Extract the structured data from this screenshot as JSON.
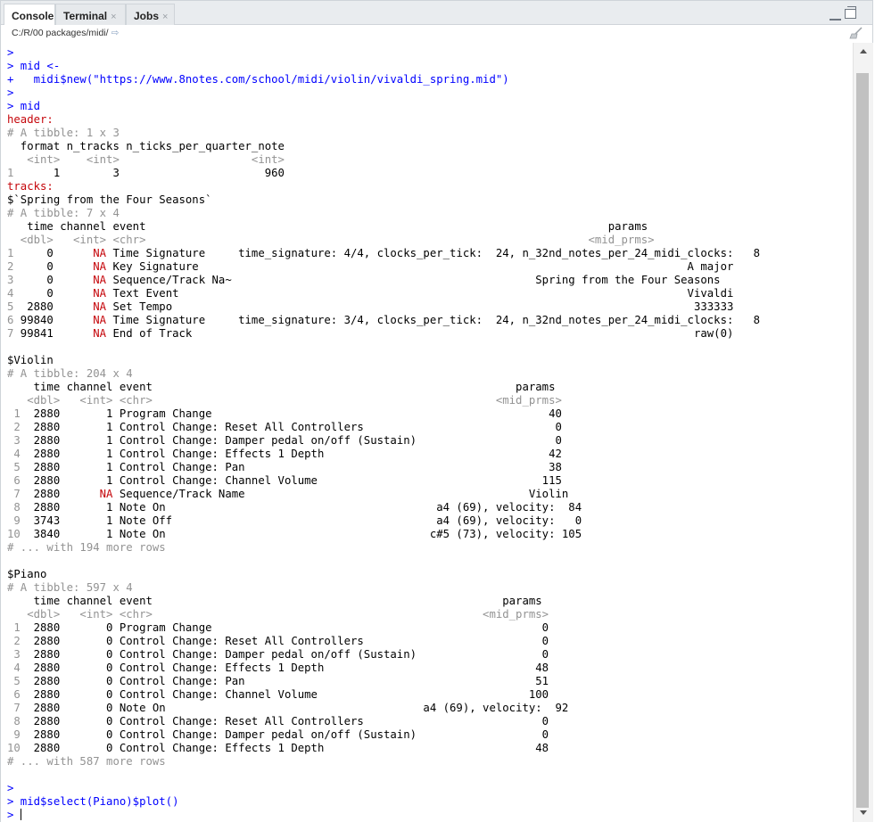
{
  "tabs": [
    {
      "label": "Console",
      "active": true
    },
    {
      "label": "Terminal",
      "close": "×"
    },
    {
      "label": "Jobs",
      "close": "×"
    }
  ],
  "path": "C:/R/00 packages/midi/",
  "console_lines": [
    {
      "segs": [
        {
          "t": ">",
          "c": "prompt"
        }
      ]
    },
    {
      "segs": [
        {
          "t": "> mid <-",
          "c": "prompt"
        }
      ]
    },
    {
      "segs": [
        {
          "t": "+   midi$new(\"https://www.8notes.com/school/midi/violin/vivaldi_spring.mid\")",
          "c": "prompt"
        }
      ]
    },
    {
      "segs": [
        {
          "t": ">",
          "c": "prompt"
        }
      ]
    },
    {
      "segs": [
        {
          "t": "> mid",
          "c": "prompt"
        }
      ]
    },
    {
      "segs": [
        {
          "t": "header:",
          "c": "red"
        }
      ]
    },
    {
      "segs": [
        {
          "t": "# A tibble: 1 x 3",
          "c": "gray"
        }
      ]
    },
    {
      "segs": [
        {
          "t": "  format n_tracks n_ticks_per_quarter_note"
        }
      ]
    },
    {
      "segs": [
        {
          "t": "   <int>    <int>                    <int>",
          "c": "gray"
        }
      ]
    },
    {
      "segs": [
        {
          "t": "1",
          "c": "gray"
        },
        {
          "t": "      1        3                      960"
        }
      ]
    },
    {
      "segs": [
        {
          "t": "tracks:",
          "c": "red"
        }
      ]
    },
    {
      "segs": [
        {
          "t": "$`Spring from the Four Seasons`"
        }
      ]
    },
    {
      "segs": [
        {
          "t": "# A tibble: 7 x 4",
          "c": "gray"
        }
      ]
    },
    {
      "segs": [
        {
          "t": "   time channel event                                                                      params"
        }
      ]
    },
    {
      "segs": [
        {
          "t": "  <dbl>   <int> <chr>                                                                   <mid_prms>",
          "c": "gray"
        }
      ]
    },
    {
      "segs": [
        {
          "t": "1",
          "c": "gray"
        },
        {
          "t": "     0      "
        },
        {
          "t": "NA",
          "c": "na"
        },
        {
          "t": " Time Signature     time_signature: 4/4, clocks_per_tick:  24, n_32nd_notes_per_24_midi_clocks:   8"
        }
      ]
    },
    {
      "segs": [
        {
          "t": "2",
          "c": "gray"
        },
        {
          "t": "     0      "
        },
        {
          "t": "NA",
          "c": "na"
        },
        {
          "t": " Key Signature                                                                          A major"
        }
      ]
    },
    {
      "segs": [
        {
          "t": "3",
          "c": "gray"
        },
        {
          "t": "     0      "
        },
        {
          "t": "NA",
          "c": "na"
        },
        {
          "t": " Sequence/Track Na~                                              Spring from the Four Seasons"
        }
      ]
    },
    {
      "segs": [
        {
          "t": "4",
          "c": "gray"
        },
        {
          "t": "     0      "
        },
        {
          "t": "NA",
          "c": "na"
        },
        {
          "t": " Text Event                                                                             Vivaldi"
        }
      ]
    },
    {
      "segs": [
        {
          "t": "5",
          "c": "gray"
        },
        {
          "t": "  2880      "
        },
        {
          "t": "NA",
          "c": "na"
        },
        {
          "t": " Set Tempo                                                                               333333"
        }
      ]
    },
    {
      "segs": [
        {
          "t": "6",
          "c": "gray"
        },
        {
          "t": " 99840      "
        },
        {
          "t": "NA",
          "c": "na"
        },
        {
          "t": " Time Signature     time_signature: 3/4, clocks_per_tick:  24, n_32nd_notes_per_24_midi_clocks:   8"
        }
      ]
    },
    {
      "segs": [
        {
          "t": "7",
          "c": "gray"
        },
        {
          "t": " 99841      "
        },
        {
          "t": "NA",
          "c": "na"
        },
        {
          "t": " End of Track                                                                            raw(0)"
        }
      ]
    },
    {
      "segs": [
        {
          "t": " "
        }
      ]
    },
    {
      "segs": [
        {
          "t": "$Violin"
        }
      ]
    },
    {
      "segs": [
        {
          "t": "# A tibble: 204 x 4",
          "c": "gray"
        }
      ]
    },
    {
      "segs": [
        {
          "t": "    time channel event                                                       params"
        }
      ]
    },
    {
      "segs": [
        {
          "t": "   <dbl>   <int> <chr>                                                    <mid_prms>",
          "c": "gray"
        }
      ]
    },
    {
      "segs": [
        {
          "t": " 1",
          "c": "gray"
        },
        {
          "t": "  2880       1 Program Change                                                   40"
        }
      ]
    },
    {
      "segs": [
        {
          "t": " 2",
          "c": "gray"
        },
        {
          "t": "  2880       1 Control Change: Reset All Controllers                             0"
        }
      ]
    },
    {
      "segs": [
        {
          "t": " 3",
          "c": "gray"
        },
        {
          "t": "  2880       1 Control Change: Damper pedal on/off (Sustain)                     0"
        }
      ]
    },
    {
      "segs": [
        {
          "t": " 4",
          "c": "gray"
        },
        {
          "t": "  2880       1 Control Change: Effects 1 Depth                                  42"
        }
      ]
    },
    {
      "segs": [
        {
          "t": " 5",
          "c": "gray"
        },
        {
          "t": "  2880       1 Control Change: Pan                                              38"
        }
      ]
    },
    {
      "segs": [
        {
          "t": " 6",
          "c": "gray"
        },
        {
          "t": "  2880       1 Control Change: Channel Volume                                  115"
        }
      ]
    },
    {
      "segs": [
        {
          "t": " 7",
          "c": "gray"
        },
        {
          "t": "  2880      "
        },
        {
          "t": "NA",
          "c": "na"
        },
        {
          "t": " Sequence/Track Name                                           Violin"
        }
      ]
    },
    {
      "segs": [
        {
          "t": " 8",
          "c": "gray"
        },
        {
          "t": "  2880       1 Note On                                         a4 (69), velocity:  84"
        }
      ]
    },
    {
      "segs": [
        {
          "t": " 9",
          "c": "gray"
        },
        {
          "t": "  3743       1 Note Off                                        a4 (69), velocity:   0"
        }
      ]
    },
    {
      "segs": [
        {
          "t": "10",
          "c": "gray"
        },
        {
          "t": "  3840       1 Note On                                        c#5 (73), velocity: 105"
        }
      ]
    },
    {
      "segs": [
        {
          "t": "# ... with 194 more rows",
          "c": "gray"
        }
      ]
    },
    {
      "segs": [
        {
          "t": " "
        }
      ]
    },
    {
      "segs": [
        {
          "t": "$Piano"
        }
      ]
    },
    {
      "segs": [
        {
          "t": "# A tibble: 597 x 4",
          "c": "gray"
        }
      ]
    },
    {
      "segs": [
        {
          "t": "    time channel event                                                     params"
        }
      ]
    },
    {
      "segs": [
        {
          "t": "   <dbl>   <int> <chr>                                                  <mid_prms>",
          "c": "gray"
        }
      ]
    },
    {
      "segs": [
        {
          "t": " 1",
          "c": "gray"
        },
        {
          "t": "  2880       0 Program Change                                                  0"
        }
      ]
    },
    {
      "segs": [
        {
          "t": " 2",
          "c": "gray"
        },
        {
          "t": "  2880       0 Control Change: Reset All Controllers                           0"
        }
      ]
    },
    {
      "segs": [
        {
          "t": " 3",
          "c": "gray"
        },
        {
          "t": "  2880       0 Control Change: Damper pedal on/off (Sustain)                   0"
        }
      ]
    },
    {
      "segs": [
        {
          "t": " 4",
          "c": "gray"
        },
        {
          "t": "  2880       0 Control Change: Effects 1 Depth                                48"
        }
      ]
    },
    {
      "segs": [
        {
          "t": " 5",
          "c": "gray"
        },
        {
          "t": "  2880       0 Control Change: Pan                                            51"
        }
      ]
    },
    {
      "segs": [
        {
          "t": " 6",
          "c": "gray"
        },
        {
          "t": "  2880       0 Control Change: Channel Volume                                100"
        }
      ]
    },
    {
      "segs": [
        {
          "t": " 7",
          "c": "gray"
        },
        {
          "t": "  2880       0 Note On                                       a4 (69), velocity:  92"
        }
      ]
    },
    {
      "segs": [
        {
          "t": " 8",
          "c": "gray"
        },
        {
          "t": "  2880       0 Control Change: Reset All Controllers                           0"
        }
      ]
    },
    {
      "segs": [
        {
          "t": " 9",
          "c": "gray"
        },
        {
          "t": "  2880       0 Control Change: Damper pedal on/off (Sustain)                   0"
        }
      ]
    },
    {
      "segs": [
        {
          "t": "10",
          "c": "gray"
        },
        {
          "t": "  2880       0 Control Change: Effects 1 Depth                                48"
        }
      ]
    },
    {
      "segs": [
        {
          "t": "# ... with 587 more rows",
          "c": "gray"
        }
      ]
    },
    {
      "segs": [
        {
          "t": " "
        }
      ]
    },
    {
      "segs": [
        {
          "t": ">",
          "c": "prompt"
        }
      ]
    },
    {
      "segs": [
        {
          "t": "> mid$select(Piano)$plot()",
          "c": "prompt"
        }
      ]
    }
  ],
  "input_prompt": "> "
}
